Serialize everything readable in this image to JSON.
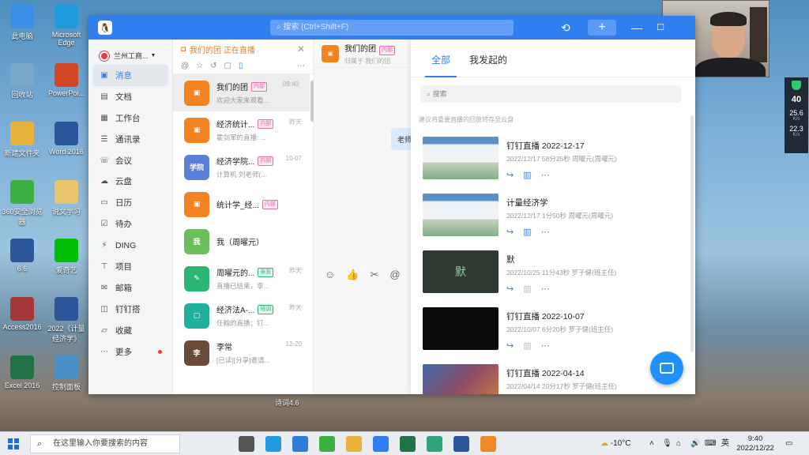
{
  "desktop": {
    "icons": [
      {
        "label": "此电脑",
        "icon": "computer-icon",
        "color": "#3a8ee6"
      },
      {
        "label": "Microsoft Edge",
        "icon": "edge-icon",
        "color": "#1f9bde"
      },
      {
        "label": "回收站",
        "icon": "recycle-bin-icon",
        "color": "#7aa7c7"
      },
      {
        "label": "PowerPoi...",
        "icon": "powerpoint-icon",
        "color": "#d24726"
      },
      {
        "label": "新建文件夹",
        "icon": "folder-icon",
        "color": "#e8b33a"
      },
      {
        "label": "Word 2016",
        "icon": "word-icon",
        "color": "#2b579a"
      },
      {
        "label": "360安全浏览器",
        "icon": "browser-360-icon",
        "color": "#3cb043"
      },
      {
        "label": "说文学习",
        "icon": "folder-icon",
        "color": "#e8c56a"
      },
      {
        "label": "6.6",
        "icon": "word-icon",
        "color": "#2b579a"
      },
      {
        "label": "爱奇艺",
        "icon": "iqiyi-icon",
        "color": "#00be06"
      },
      {
        "label": "Access2016",
        "icon": "access-icon",
        "color": "#a4373a"
      },
      {
        "label": "2022《计量经济学》",
        "icon": "word-icon",
        "color": "#2b579a"
      },
      {
        "label": "Excel 2016",
        "icon": "excel-icon",
        "color": "#217346"
      },
      {
        "label": "控制面板",
        "icon": "control-panel-icon",
        "color": "#4a90c8"
      }
    ],
    "watermark": "诗词4.6"
  },
  "netwidget": {
    "percent": "40",
    "down": "25.6",
    "up": "22.3",
    "unit": "K/s"
  },
  "app": {
    "search_placeholder": "搜索 (Ctrl+Shift+F)",
    "org_name": "兰州工商...",
    "nav": [
      {
        "label": "消息",
        "icon": "message-icon",
        "glyph": "▣",
        "active": true
      },
      {
        "label": "文档",
        "icon": "document-icon",
        "glyph": "▤"
      },
      {
        "label": "工作台",
        "icon": "workbench-icon",
        "glyph": "▦"
      },
      {
        "label": "通讯录",
        "icon": "contacts-icon",
        "glyph": "☰"
      },
      {
        "label": "会议",
        "icon": "meeting-icon",
        "glyph": "☏"
      },
      {
        "label": "云盘",
        "icon": "cloud-icon",
        "glyph": "☁"
      },
      {
        "label": "日历",
        "icon": "calendar-icon",
        "glyph": "▭"
      },
      {
        "label": "待办",
        "icon": "todo-icon",
        "glyph": "☑"
      },
      {
        "label": "DING",
        "icon": "ding-icon",
        "glyph": "⚡"
      },
      {
        "label": "项目",
        "icon": "project-icon",
        "glyph": "⊤"
      },
      {
        "label": "邮箱",
        "icon": "mail-icon",
        "glyph": "✉"
      },
      {
        "label": "钉钉搭",
        "icon": "dingda-icon",
        "glyph": "◫"
      },
      {
        "label": "收藏",
        "icon": "favorite-icon",
        "glyph": "▱"
      },
      {
        "label": "更多",
        "icon": "more-icon",
        "glyph": "⋯",
        "dot": true
      }
    ],
    "live_banner": "我们的团 正在直播",
    "conversations": [
      {
        "name": "我们的团",
        "tag": "内部",
        "snippet": "欢迎大家来观看...",
        "time": "09:40",
        "color": "#f58220",
        "avatar": "▣",
        "selected": true
      },
      {
        "name": "经济统计...",
        "tag": "内部",
        "snippet": "霍剑军的直播: ...",
        "time": "昨天",
        "color": "#f58220",
        "avatar": "▣"
      },
      {
        "name": "经济学院...",
        "tag": "内部",
        "snippet": "计算机 刘老师(...",
        "time": "10-07",
        "color": "#5a7fd6",
        "avatar": "学院"
      },
      {
        "name": "统计学_经...",
        "tag": "内部",
        "snippet": "",
        "time": "",
        "color": "#f58220",
        "avatar": "▣"
      },
      {
        "name": "我（周曜元）",
        "tag": "",
        "snippet": "",
        "time": "",
        "color": "#6bbf5a",
        "avatar": "我"
      },
      {
        "name": "周曜元的...",
        "tag": "亲友",
        "snippet": "直播已结束，李...",
        "time": "昨天",
        "color": "#2bb673",
        "avatar": "✎"
      },
      {
        "name": "经济法A-...",
        "tag": "培训",
        "snippet": "任翰的直播：钉...",
        "time": "昨天",
        "color": "#1fb09a",
        "avatar": "▢"
      },
      {
        "name": "李常",
        "tag": "",
        "snippet": "[已读][分享]邀请...",
        "time": "12-20",
        "color": "#6b4a3a",
        "avatar": "李"
      }
    ],
    "chat": {
      "title": "我们的团",
      "tag": "内部",
      "subtitle": "归属于 我们的团",
      "bubble": "老师"
    },
    "panel": {
      "tabs": [
        "全部",
        "我发起的"
      ],
      "search_placeholder": "搜索",
      "tip": "建议将重要直播的回放转存至云盘",
      "records": [
        {
          "title": "钉钉直播 2022-12-17",
          "meta": "2022/12/17  58分25秒  周曜元(周曜元)",
          "thumb": "screen",
          "stats_active": true
        },
        {
          "title": "计量经济学",
          "meta": "2022/12/17  1分50秒  周曜元(周曜元)",
          "thumb": "screen",
          "stats_active": true
        },
        {
          "title": "默",
          "meta": "2022/10/25  11分43秒  罗子健(班主任)",
          "thumb": "dark-text",
          "thumb_text": "默",
          "stats_active": false
        },
        {
          "title": "钉钉直播 2022-10-07",
          "meta": "2022/10/07  6分20秒  罗子健(班主任)",
          "thumb": "black",
          "stats_active": false
        },
        {
          "title": "钉钉直播 2022-04-14",
          "meta": "2022/04/14  20分17秒  罗子健(班主任)",
          "thumb": "desktop",
          "stats_active": false
        }
      ]
    }
  },
  "taskbar": {
    "search_placeholder": "在这里输入你要搜索的内容",
    "weather": "-10°C",
    "ime": "英",
    "time": "9:40",
    "date": "2022/12/22",
    "apps": [
      {
        "icon": "task-view-icon",
        "color": "#555"
      },
      {
        "icon": "edge-icon",
        "color": "#1f9bde"
      },
      {
        "icon": "mail-icon",
        "color": "#2f7bd8"
      },
      {
        "icon": "browser-360-icon",
        "color": "#3cb043"
      },
      {
        "icon": "file-explorer-icon",
        "color": "#e8b33a"
      },
      {
        "icon": "dingtalk-icon",
        "color": "#2f7ff0"
      },
      {
        "icon": "excel-icon",
        "color": "#217346"
      },
      {
        "icon": "dingtalk-live-icon",
        "color": "#2fa37a"
      },
      {
        "icon": "word-icon",
        "color": "#2b579a"
      },
      {
        "icon": "video-icon",
        "color": "#f08a24"
      }
    ]
  }
}
